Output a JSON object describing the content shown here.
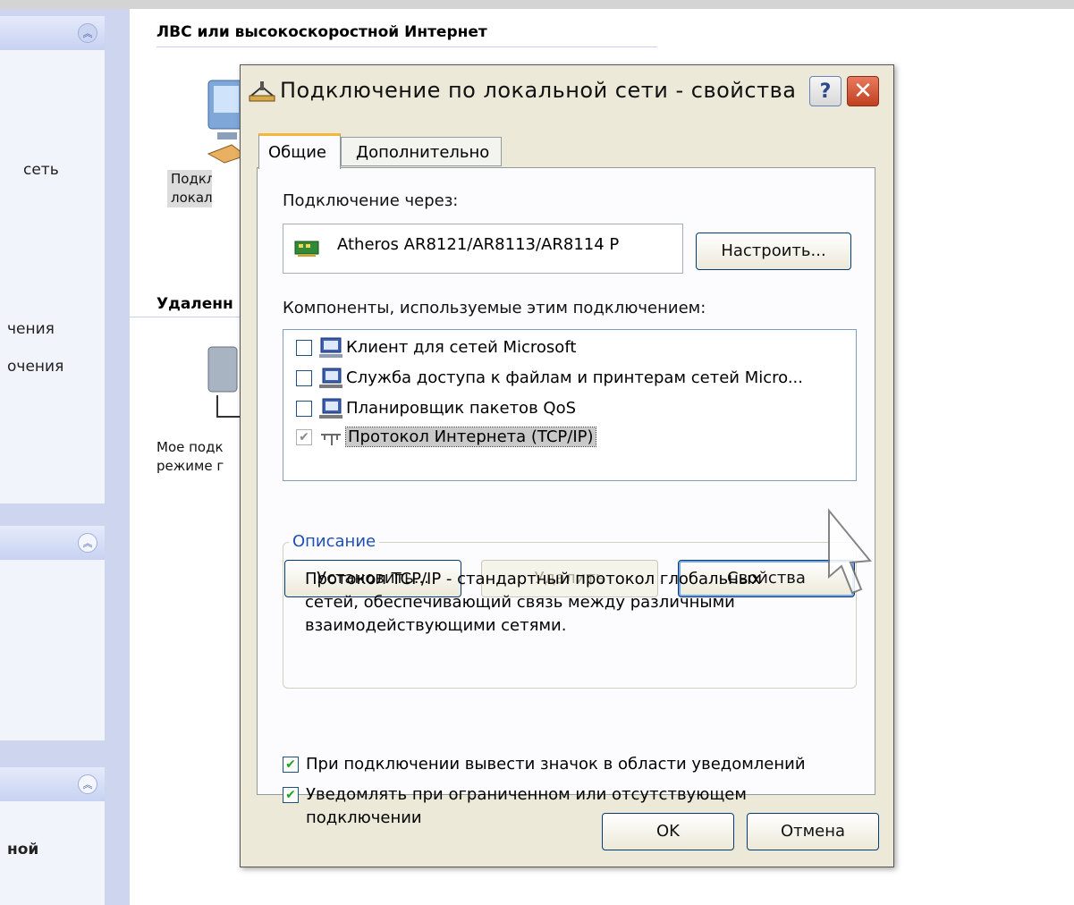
{
  "background": {
    "group1_title": "ЛВС или высокоскоростной Интернет",
    "group2_title": "Удаленн",
    "connection1_label_line1": "Подклю",
    "connection1_label_line2": "локаль",
    "connection2_label_line1": "Мое подк",
    "connection2_label_line2": "режиме г",
    "pane_text_1": "сеть",
    "pane_text_2": "чения",
    "pane_text_3": "очения",
    "pane_text_4": "ной"
  },
  "dialog": {
    "title": "Подключение по локальной сети - свойства",
    "help_label": "?",
    "close_label": "✕",
    "tabs": [
      {
        "label": "Общие"
      },
      {
        "label": "Дополнительно"
      }
    ],
    "connect_via_label": "Подключение через:",
    "adapter_name": "Atheros AR8121/AR8113/AR8114 P",
    "configure_button": "Настроить...",
    "components_label": "Компоненты, используемые этим подключением:",
    "components": [
      {
        "label": "Клиент для сетей Microsoft",
        "checked": false,
        "icon": "network-client-icon"
      },
      {
        "label": "Служба доступа к файлам и принтерам сетей Micro...",
        "checked": false,
        "icon": "network-service-icon"
      },
      {
        "label": "Планировщик пакетов QoS",
        "checked": false,
        "icon": "network-service-icon"
      },
      {
        "label": "Протокол Интернета (TCP/IP)",
        "checked": true,
        "icon": "protocol-icon",
        "selected": true
      }
    ],
    "install_button": "Установить...",
    "remove_button": "Удалить",
    "properties_button": "Свойства",
    "description_legend": "Описание",
    "description_text": "Протокол TCP/IP - стандартный протокол глобальных сетей, обеспечивающий связь между различными взаимодействующими сетями.",
    "show_icon_label": "При подключении вывести значок в области уведомлений",
    "notify_label": "Уведомлять при ограниченном или отсутствующем подключении",
    "ok_button": "OK",
    "cancel_button": "Отмена"
  }
}
